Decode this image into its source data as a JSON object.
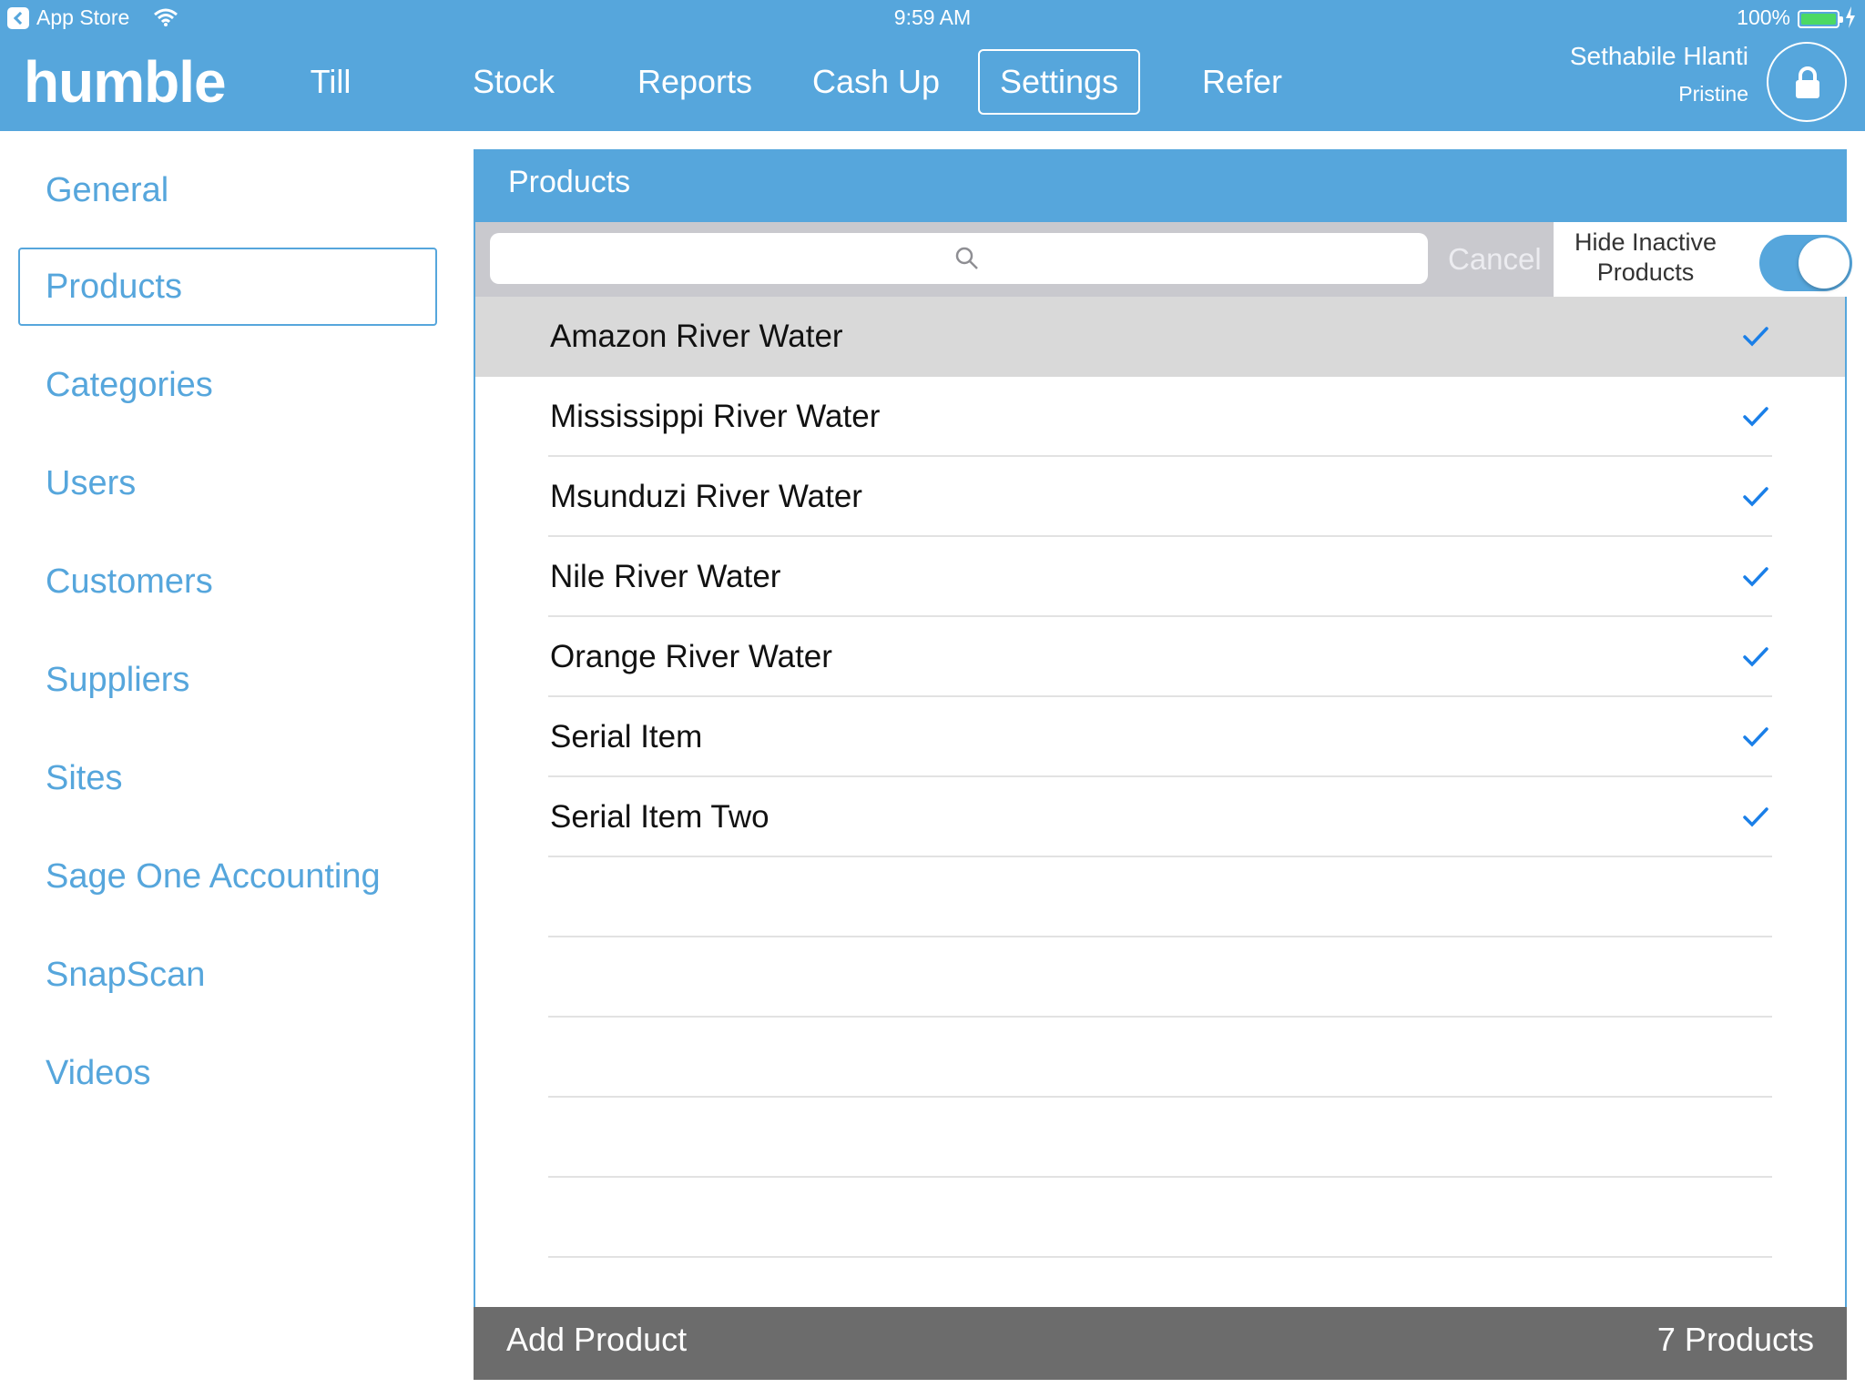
{
  "status_bar": {
    "back_app": "App Store",
    "time": "9:59 AM",
    "battery": "100%"
  },
  "header": {
    "logo": "humble",
    "nav": [
      {
        "label": "Till"
      },
      {
        "label": "Stock"
      },
      {
        "label": "Reports"
      },
      {
        "label": "Cash Up"
      },
      {
        "label": "Settings",
        "active": true
      },
      {
        "label": "Refer"
      }
    ],
    "user_name": "Sethabile Hlanti",
    "site_name": "Pristine"
  },
  "sidebar": {
    "items": [
      {
        "label": "General"
      },
      {
        "label": "Products",
        "active": true
      },
      {
        "label": "Categories"
      },
      {
        "label": "Users"
      },
      {
        "label": "Customers"
      },
      {
        "label": "Suppliers"
      },
      {
        "label": "Sites"
      },
      {
        "label": "Sage One Accounting"
      },
      {
        "label": "SnapScan"
      },
      {
        "label": "Videos"
      }
    ]
  },
  "products_panel": {
    "title": "Products",
    "search": {
      "placeholder": "",
      "value": ""
    },
    "cancel_label": "Cancel",
    "hide_inactive_label_1": "Hide Inactive",
    "hide_inactive_label_2": "Products",
    "hide_inactive_on": true,
    "rows": [
      {
        "name": "Amazon River Water",
        "checked": true,
        "selected": true
      },
      {
        "name": "Mississippi River Water",
        "checked": true
      },
      {
        "name": "Msunduzi River Water",
        "checked": true
      },
      {
        "name": "Nile River Water",
        "checked": true
      },
      {
        "name": "Orange River Water",
        "checked": true
      },
      {
        "name": "Serial Item",
        "checked": true
      },
      {
        "name": "Serial Item Two",
        "checked": true
      }
    ],
    "add_product_label": "Add Product",
    "product_count": "7 Products"
  },
  "colors": {
    "brand_blue": "#56a6dc",
    "footer_gray": "#6c6c6c",
    "selected_row": "#d9d9d9",
    "checkmark_blue": "#1a7fe8"
  }
}
